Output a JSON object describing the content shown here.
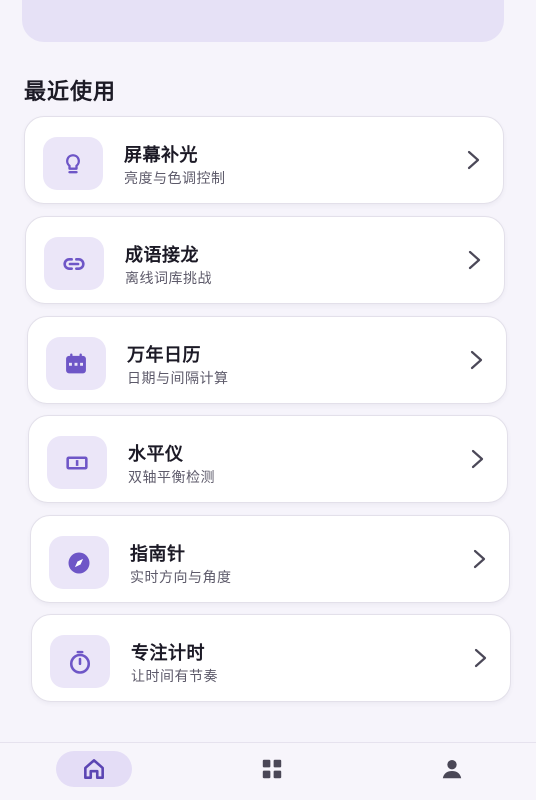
{
  "section": {
    "title": "最近使用"
  },
  "recent": [
    {
      "title": "屏幕补光",
      "subtitle": "亮度与色调控制",
      "icon": "lightbulb-icon"
    },
    {
      "title": "成语接龙",
      "subtitle": "离线词库挑战",
      "icon": "link-icon"
    },
    {
      "title": "万年日历",
      "subtitle": "日期与间隔计算",
      "icon": "calendar-icon"
    },
    {
      "title": "水平仪",
      "subtitle": "双轴平衡检测",
      "icon": "level-icon"
    },
    {
      "title": "指南针",
      "subtitle": "实时方向与角度",
      "icon": "compass-icon"
    },
    {
      "title": "专注计时",
      "subtitle": "让时间有节奏",
      "icon": "timer-icon"
    }
  ],
  "tabbar": {
    "items": [
      {
        "icon": "home-icon",
        "active": true
      },
      {
        "icon": "apps-grid-icon",
        "active": false
      },
      {
        "icon": "person-icon",
        "active": false
      }
    ]
  },
  "colors": {
    "background": "#f6f4fb",
    "accent": "#6e56c7",
    "icon_bg": "#ebe6f8",
    "active_tab_bg": "#e4ddf6"
  }
}
